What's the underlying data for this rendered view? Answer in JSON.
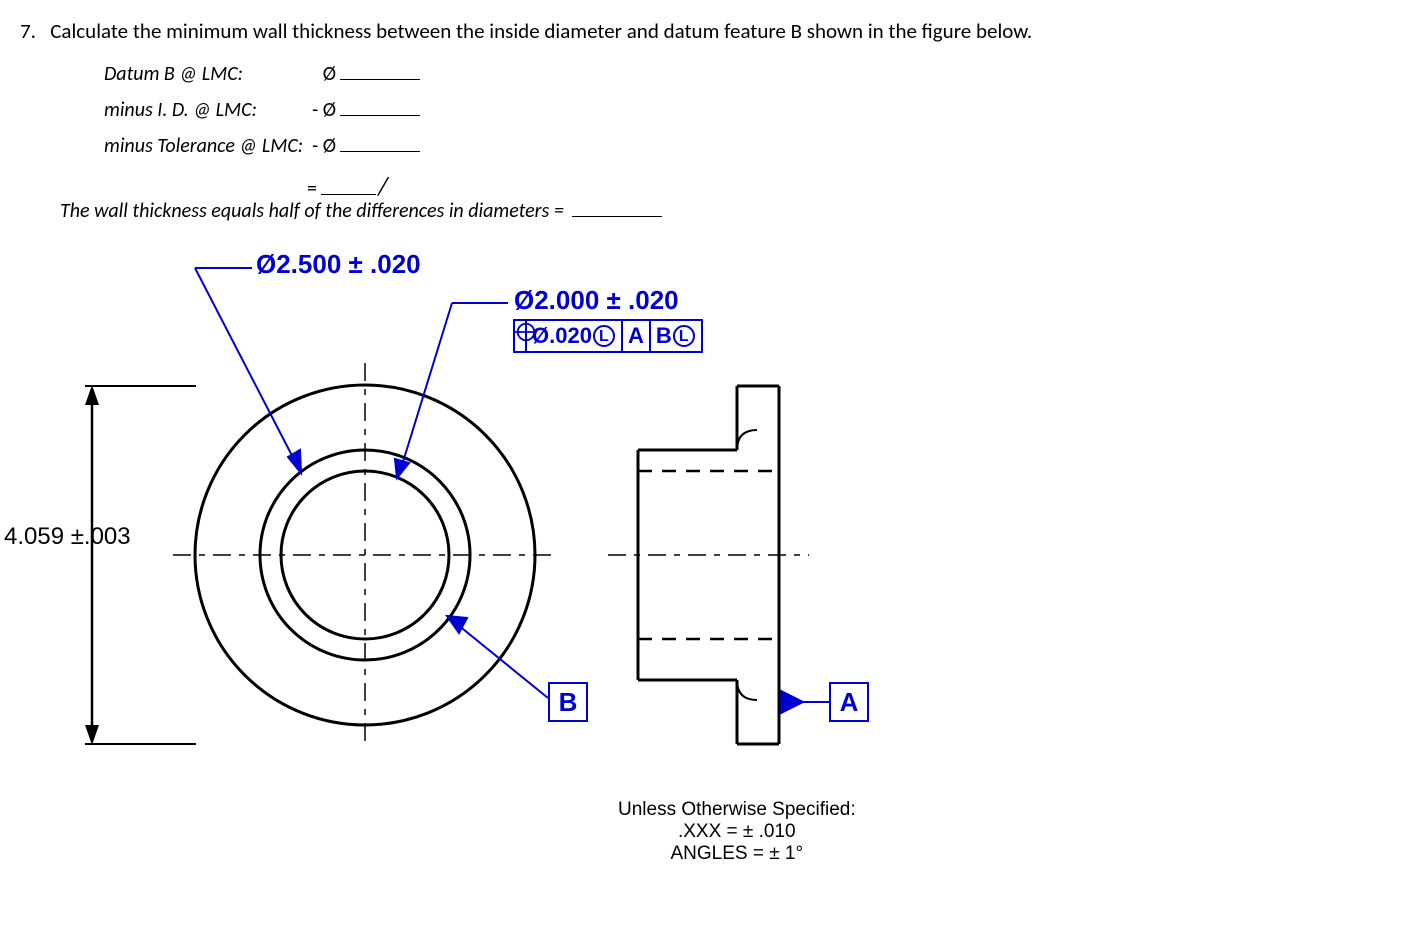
{
  "question": {
    "number": "7.",
    "text": "Calculate the minimum wall thickness between the inside diameter and datum feature B shown in the figure below."
  },
  "worksheet": {
    "line1_label": "Datum B @ LMC:",
    "line1_sym": "Ø",
    "line2_label": "minus I. D. @ LMC:",
    "line2_sym": "- Ø",
    "line3_label": "minus Tolerance @ LMC:",
    "line3_sym": "- Ø",
    "equals": "="
  },
  "wall_text": "The wall thickness equals half of the differences in diameters =",
  "dims": {
    "od_flange": "Ø2.500 ± .020",
    "id_hole": "Ø2.000 ± .020",
    "height": "4.059 ±.003"
  },
  "fcf": {
    "tol": "Ø.020",
    "mod": "L",
    "datum1": "A",
    "datum2": "B",
    "datum2_mod": "L"
  },
  "datums": {
    "b": "B",
    "a": "A"
  },
  "note": {
    "line1": "Unless Otherwise Specified:",
    "line2": ".XXX = ± .010",
    "line3": "ANGLES = ± 1°"
  }
}
